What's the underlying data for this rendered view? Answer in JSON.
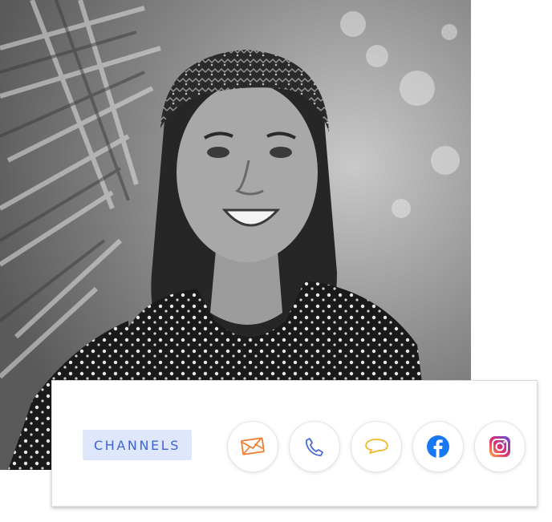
{
  "card": {
    "label": "CHANNELS",
    "accent_color": "#3d64d8",
    "badge_bg": "#dfe7fd"
  },
  "channels": [
    {
      "icon": "email-icon",
      "color": "#f07c2b"
    },
    {
      "icon": "phone-icon",
      "color": "#4a6ad9"
    },
    {
      "icon": "chat-bubble-icon",
      "color": "#f0b92b"
    },
    {
      "icon": "facebook-icon",
      "color": "#1877f2"
    },
    {
      "icon": "instagram-icon",
      "color": "#d6249f"
    }
  ]
}
